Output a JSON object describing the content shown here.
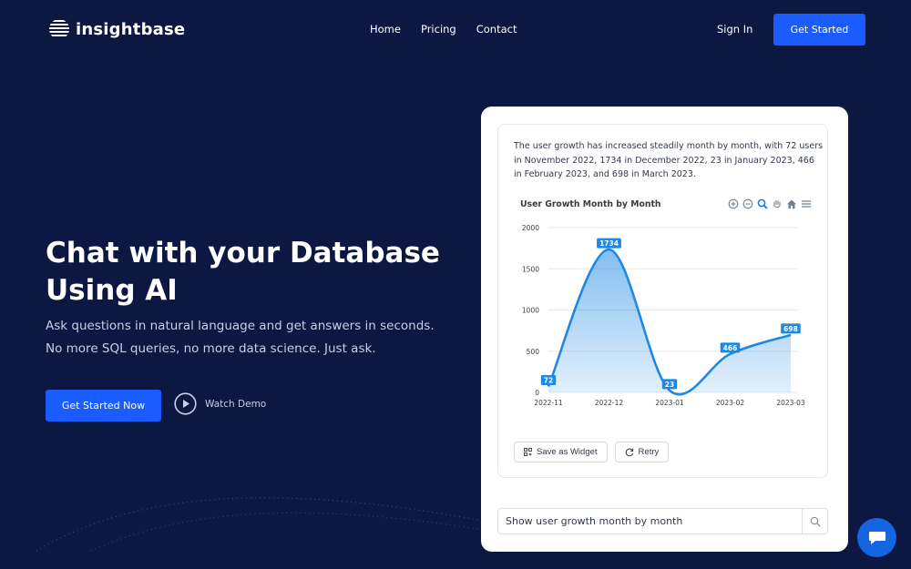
{
  "nav": {
    "logo_text": "insightbase",
    "links": [
      "Home",
      "Pricing",
      "Contact"
    ],
    "sign_in": "Sign In",
    "cta": "Get Started"
  },
  "hero": {
    "title": "Chat with your Database Using AI",
    "subtitle": "Ask questions in natural language and get answers in seconds. No more SQL queries, no more data science. Just ask.",
    "cta": "Get Started Now",
    "watch_demo": "Watch Demo"
  },
  "card": {
    "summary": "The user growth has increased steadily month by month, with 72 users in November 2022, 1734 in December 2022, 23 in January 2023, 466 in February 2023, and 698 in March 2023.",
    "save_widget": "Save as Widget",
    "retry": "Retry",
    "search_value": "Show user growth month by month"
  },
  "icons": {
    "logo": "logo-stripes-icon",
    "play": "play-circle-icon",
    "zoom_in": "zoom-in-icon",
    "zoom_out": "zoom-out-icon",
    "zoom_select": "magnifier-icon",
    "pan": "hand-pan-icon",
    "reset": "home-icon",
    "menu": "menu-icon",
    "widget": "widget-icon",
    "retry": "retry-icon",
    "search": "search-icon",
    "chat": "chat-bubble-icon"
  },
  "colors": {
    "background": "#0c1742",
    "primary": "#1a5cff",
    "series": "#1e88e5",
    "chat": "#1565e0"
  },
  "chart_data": {
    "type": "area",
    "title": "User Growth Month by Month",
    "categories": [
      "2022-11",
      "2022-12",
      "2023-01",
      "2023-02",
      "2023-03"
    ],
    "values": [
      72,
      1734,
      23,
      466,
      698
    ],
    "y_ticks": [
      0,
      500,
      1000,
      1500,
      2000
    ],
    "ylim": [
      0,
      2000
    ],
    "grid": true,
    "data_labels": true,
    "curve": "smooth"
  }
}
